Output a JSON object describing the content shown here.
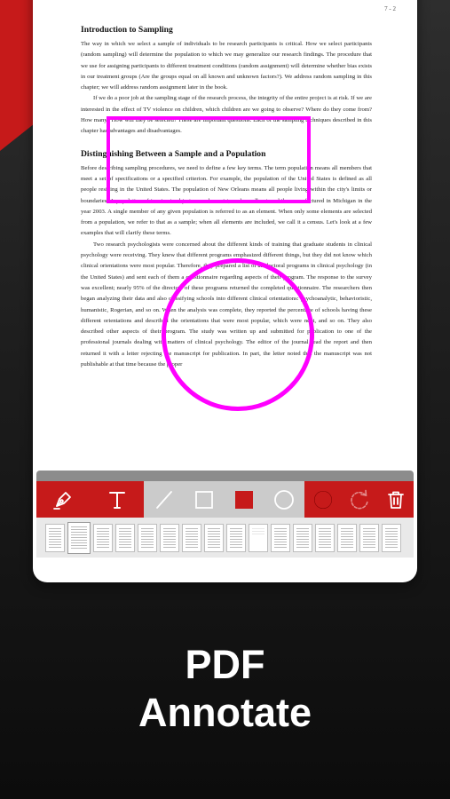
{
  "page_number": "7 - 2",
  "document": {
    "heading1": "Introduction to Sampling",
    "para1": "The way in which we select a sample of individuals to be research participants is critical. How we select participants (random sampling) will determine the population to which we may generalize our research findings. The procedure that we use for assigning participants to different treatment conditions (random assignment) will determine whether bias exists in our treatment groups (Are the groups equal on all known and unknown factors?). We address random sampling in this chapter; we will address random assignment later in the book.",
    "para2": "If we do a poor job at the sampling stage of the research process, the integrity of the entire project is at risk. If we are interested in the effect of TV violence on children, which children are we going to observe? Where do they come from? How many? How will they be selected? These are important questions. Each of the sampling techniques described in this chapter has advantages and disadvantages.",
    "heading2": "Distinguishing Between a Sample and a Population",
    "para3": "Before describing sampling procedures, we need to define a few key terms. The term population means all members that meet a set of specifications or a specified criterion. For example, the population of the United States is defined as all people residing in the United States. The population of New Orleans means all people living within the city's limits or boundaries. A population of inanimate objects can also exist, such as all automobiles manufactured in Michigan in the year 2003. A single member of any given population is referred to as an element. When only some elements are selected from a population, we refer to that as a sample; when all elements are included, we call it a census. Let's look at a few examples that will clarify these terms.",
    "para4": "Two research psychologists were concerned about the different kinds of training that graduate students in clinical psychology were receiving. They knew that different programs emphasized different things, but they did not know which clinical orientations were most popular. Therefore, they prepared a list of all doctoral programs in clinical psychology (in the United States) and sent each of them a questionnaire regarding aspects of their program. The response to the survey was excellent; nearly 95% of the directors of these programs returned the completed questionnaire. The researchers then began analyzing their data and also classifying schools into different clinical orientations: psychoanalytic, behavioristic, humanistic, Rogerian, and so on. When the analysis was complete, they reported the percentage of schools having these different orientations and described the orientations that were most popular, which were next, and so on. They also described other aspects of their program. The study was written up and submitted for publication to one of the professional journals dealing with matters of clinical psychology. The editor of the journal read the report and then returned it with a letter rejecting the manuscript for publication. In part, the letter noted that the manuscript was not publishable at that time because the proper"
  },
  "annotation_color": "#ff00ff",
  "toolbar": {
    "accent_color": "#c61a1a",
    "tools": [
      "pen-icon",
      "text-icon",
      "line-icon",
      "rectangle-outline-icon",
      "rectangle-filled-icon",
      "circle-outline-icon",
      "circle-filled-icon",
      "redo-icon",
      "trash-icon"
    ]
  },
  "thumbnails": {
    "count": 16,
    "active_index": 1
  },
  "headline": {
    "line1": "PDF",
    "line2": "Annotate"
  }
}
